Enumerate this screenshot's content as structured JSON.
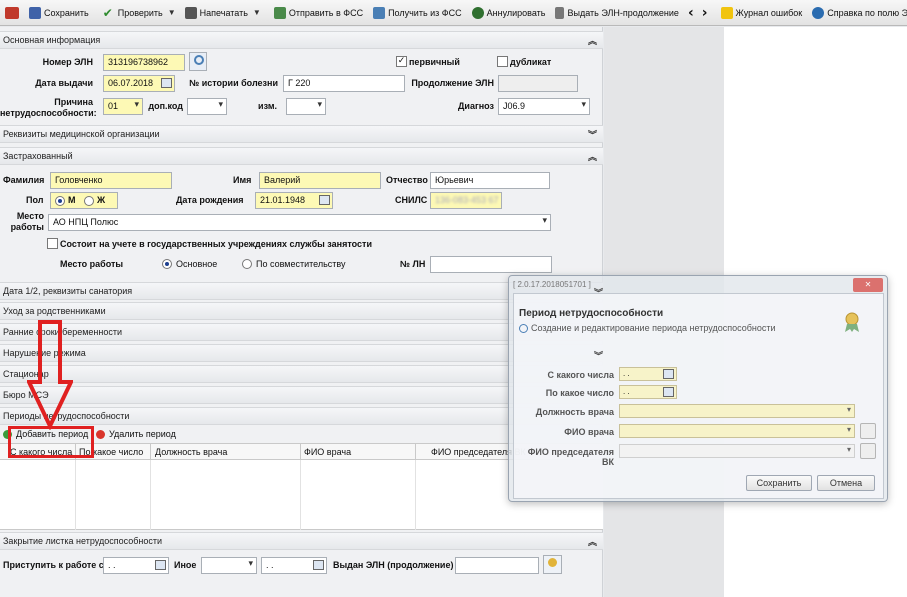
{
  "toolbar": {
    "save": "Сохранить",
    "check": "Проверить",
    "print": "Напечатать",
    "send_fss": "Отправить в ФСС",
    "receive_fss": "Получить из ФСС",
    "annul": "Аннулировать",
    "issue_continuation": "Выдать ЭЛН-продолжение",
    "error_log": "Журнал ошибок",
    "help": "Справка по полю ЭЛ"
  },
  "basic": {
    "header": "Основная информация",
    "eln_number_label": "Номер ЭЛН",
    "eln_number": "313196738962",
    "primary_label": "первичный",
    "primary_checked": true,
    "duplicate_label": "дубликат",
    "duplicate_checked": false,
    "issue_date_label": "Дата выдачи",
    "issue_date": "06.07.2018",
    "history_label": "№ истории болезни",
    "history": "Г 220",
    "continuation_label": "Продолжение ЭЛН",
    "reason_label_1": "Причина",
    "reason_label_2": "нетрудоспособности:",
    "reason": "01",
    "extra_code_label": "доп.код",
    "change_label": "изм.",
    "diagnosis_label": "Диагноз",
    "diagnosis": "J06.9"
  },
  "med_org": {
    "header": "Реквизиты медицинской организации"
  },
  "insured": {
    "header": "Застрахованный",
    "surname_label": "Фамилия",
    "surname": "Головченко",
    "name_label": "Имя",
    "name": "Валерий",
    "patronymic_label": "Отчество",
    "patronymic": "Юрьевич",
    "sex_label": "Пол",
    "sex_m": "М",
    "sex_f": "Ж",
    "birth_label": "Дата рождения",
    "birth": "21.01.1948",
    "snils_label": "СНИЛС",
    "snils": "136-083-453 67",
    "workplace_label_1": "Место",
    "workplace_label_2": "работы",
    "workplace": "АО НПЦ Полюс",
    "employment_service": "Состоит на учете в государственных учреждениях службы занятости",
    "job_label": "Место работы",
    "job_main": "Основное",
    "job_part": "По совместительству",
    "ln_label": "№ ЛН"
  },
  "sections": [
    "Дата 1/2, реквизиты санатория",
    "Уход за родственниками",
    "Ранние сроки беременности",
    "Нарушение режима",
    "Стационар",
    "Бюро МСЭ",
    "Периоды нетрудоспособности"
  ],
  "periods": {
    "add_label": "Добавить период",
    "delete_label": "Удалить период",
    "columns": [
      "С какого числа",
      "По какое число",
      "Должность врача",
      "ФИО врача",
      "ФИО председателя ВК"
    ]
  },
  "closing": {
    "header": "Закрытие листка нетрудоспособности",
    "start_work_label": "Приступить к работе с",
    "start_work": ". .",
    "other_label": "Иное",
    "other_date": ". .",
    "issued_label": "Выдан ЭЛН (продолжение)"
  },
  "dialog": {
    "version": "[ 2.0.17.2018051701 ]",
    "close_label": "✕",
    "title": "Период нетрудоспособности",
    "subtitle": "Создание и редактирование периода нетрудоспособности",
    "from_label": "С какого числа",
    "from_value": ". .",
    "to_label": "По какое число",
    "to_value": ". .",
    "position_label": "Должность врача",
    "doctor_label": "ФИО врача",
    "chair_label": "ФИО председателя ВК",
    "save": "Сохранить",
    "cancel": "Отмена"
  },
  "colors": {
    "accent_red": "#e02020",
    "required_yellow": "#fdf9b5"
  }
}
